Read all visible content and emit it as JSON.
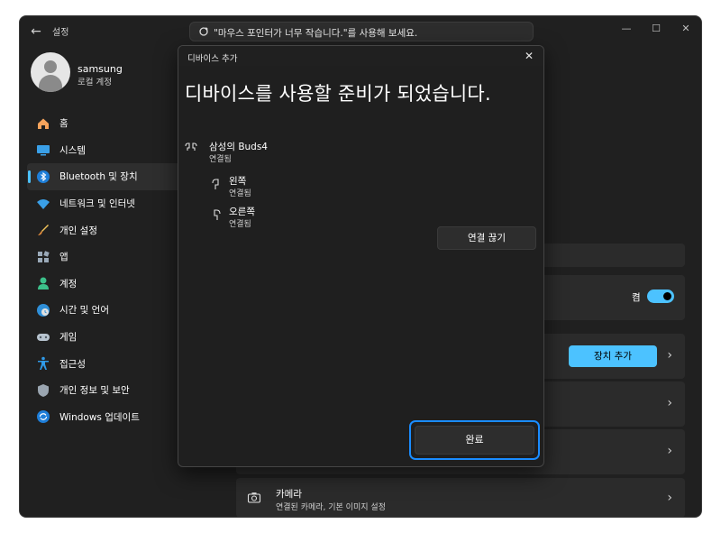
{
  "app": {
    "title": "설정",
    "back_icon": "back-arrow-icon"
  },
  "search": {
    "value": "\"마우스 포인터가 너무 작습니다.\"를 사용해 보세요.",
    "icon": "search-icon"
  },
  "window_controls": {
    "minimize": "—",
    "maximize": "☐",
    "close": "✕"
  },
  "profile": {
    "name": "samsung",
    "account_type": "로컬 계정"
  },
  "sidebar": {
    "items": [
      {
        "label": "홈",
        "icon": "home-icon"
      },
      {
        "label": "시스템",
        "icon": "system-icon"
      },
      {
        "label": "Bluetooth 및 장치",
        "icon": "bluetooth-icon",
        "active": true
      },
      {
        "label": "네트워크 및 인터넷",
        "icon": "wifi-icon"
      },
      {
        "label": "개인 설정",
        "icon": "brush-icon"
      },
      {
        "label": "앱",
        "icon": "apps-icon"
      },
      {
        "label": "계정",
        "icon": "account-icon"
      },
      {
        "label": "시간 및 언어",
        "icon": "globe-clock-icon"
      },
      {
        "label": "게임",
        "icon": "gamepad-icon"
      },
      {
        "label": "접근성",
        "icon": "accessibility-icon"
      },
      {
        "label": "개인 정보 및 보안",
        "icon": "shield-icon"
      },
      {
        "label": "Windows 업데이트",
        "icon": "update-icon"
      }
    ]
  },
  "main": {
    "bluetooth_toggle_label": "켬",
    "bluetooth_enabled": true,
    "add_device_label": "장치 추가",
    "camera": {
      "title": "카메라",
      "subtitle": "연결된 카메라, 기본 이미지 설정"
    }
  },
  "dialog": {
    "caption": "디바이스 추가",
    "heading": "디바이스를 사용할 준비가 되었습니다.",
    "device": {
      "name": "삼성의 Buds4",
      "status": "연결됨"
    },
    "left": {
      "name": "왼쪽",
      "status": "연결됨"
    },
    "right": {
      "name": "오른쪽",
      "status": "연결됨"
    },
    "disconnect_label": "연결 끊기",
    "done_label": "완료"
  },
  "colors": {
    "accent": "#4cc2ff",
    "focus_ring": "#1a8cff",
    "background": "#202020"
  }
}
